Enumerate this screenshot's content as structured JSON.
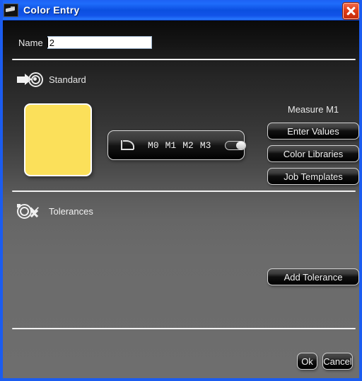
{
  "window": {
    "title": "Color Entry",
    "icon": "photo-icon",
    "close_label": "close-icon",
    "accent_color": "#1b5cf0",
    "titlebar_close_color": "#e03d17"
  },
  "form": {
    "name_label": "Name",
    "name_value": "2",
    "name_placeholder": ""
  },
  "standard_section": {
    "label": "Standard",
    "icon": "arrow-into-target-icon",
    "swatch": {
      "name": "color-swatch",
      "color": "#fbe05a"
    },
    "measure_strip": {
      "curve_icon": "curve-graph-icon",
      "measurements": [
        "M0",
        "M1",
        "M2",
        "M3"
      ],
      "toggle_state": "on"
    },
    "measure_title": "Measure M1",
    "buttons": [
      {
        "label": "Enter Values"
      },
      {
        "label": "Color Libraries"
      },
      {
        "label": "Job Templates"
      }
    ]
  },
  "tolerances_section": {
    "label": "Tolerances",
    "icon": "target-check-cross-icon",
    "add_button_label": "Add Tolerance"
  },
  "footer": {
    "ok_label": "Ok",
    "cancel_label": "Cancel"
  }
}
